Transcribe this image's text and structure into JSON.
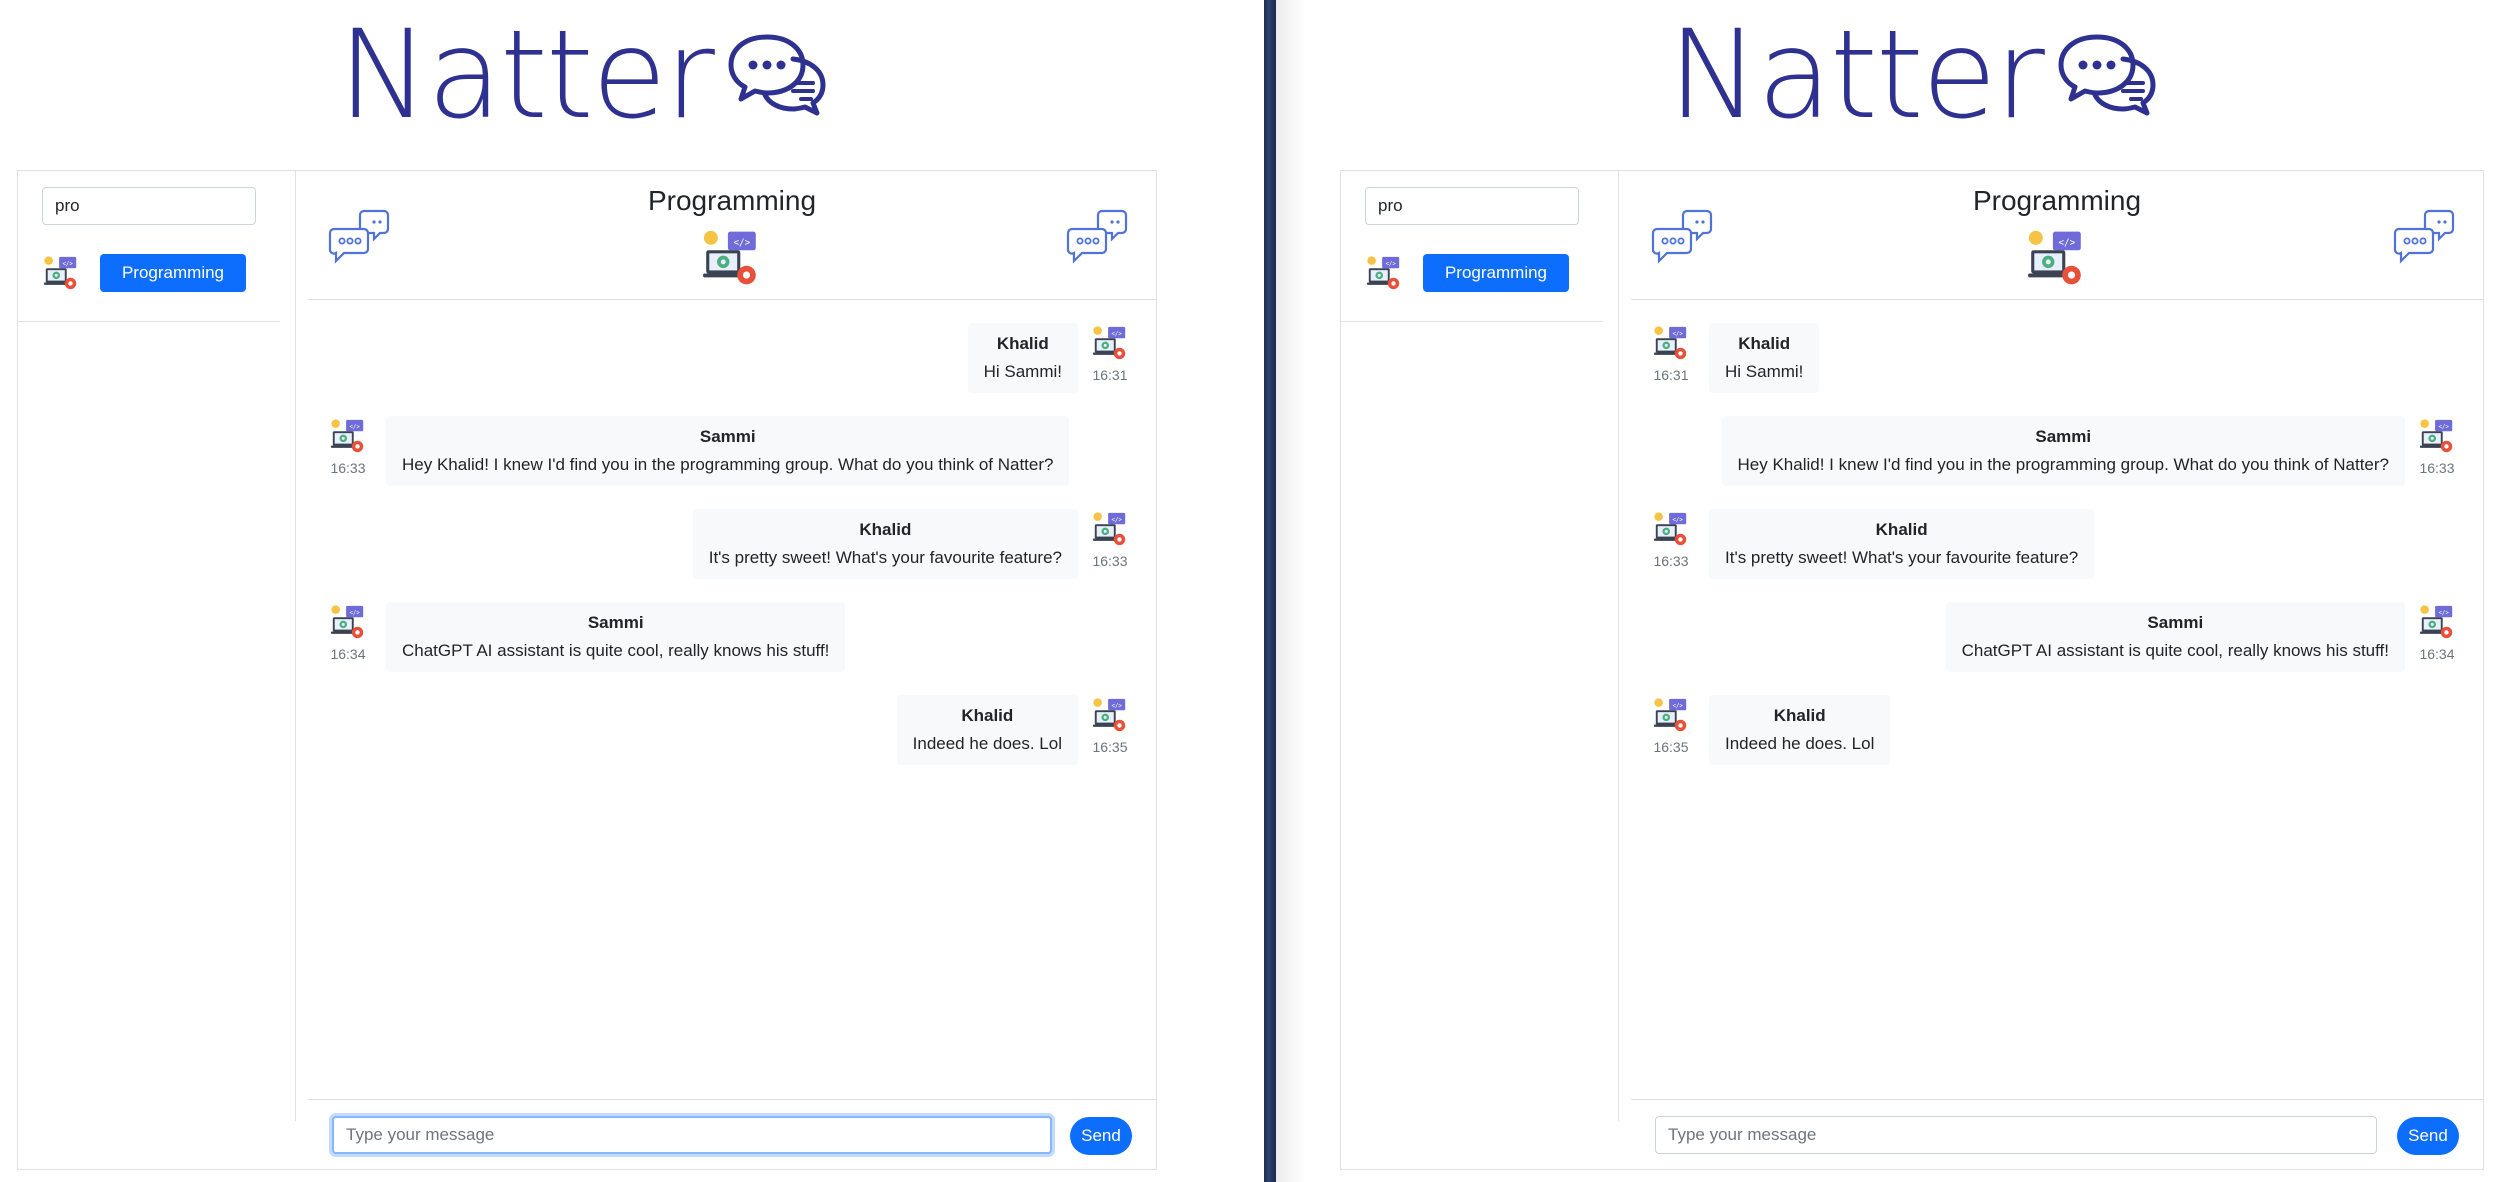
{
  "brand": {
    "name": "Natter"
  },
  "sidebar": {
    "search_value": "pro",
    "groups": [
      {
        "label": "Programming"
      }
    ]
  },
  "chat": {
    "title": "Programming",
    "composer_placeholder": "Type your message",
    "send_label": "Send"
  },
  "windows": [
    {
      "messages": [
        {
          "sender": "Khalid",
          "text": "Hi Sammi!",
          "time": "16:31",
          "align": "right"
        },
        {
          "sender": "Sammi",
          "text": "Hey Khalid! I knew I'd find you in the programming group. What do you think of Natter?",
          "time": "16:33",
          "align": "left"
        },
        {
          "sender": "Khalid",
          "text": "It's pretty sweet! What's your favourite feature?",
          "time": "16:33",
          "align": "right"
        },
        {
          "sender": "Sammi",
          "text": "ChatGPT AI assistant is quite cool, really knows his stuff!",
          "time": "16:34",
          "align": "left"
        },
        {
          "sender": "Khalid",
          "text": "Indeed he does. Lol",
          "time": "16:35",
          "align": "right"
        }
      ]
    },
    {
      "messages": [
        {
          "sender": "Khalid",
          "text": "Hi Sammi!",
          "time": "16:31",
          "align": "left"
        },
        {
          "sender": "Sammi",
          "text": "Hey Khalid! I knew I'd find you in the programming group. What do you think of Natter?",
          "time": "16:33",
          "align": "right"
        },
        {
          "sender": "Khalid",
          "text": "It's pretty sweet! What's your favourite feature?",
          "time": "16:33",
          "align": "left"
        },
        {
          "sender": "Sammi",
          "text": "ChatGPT AI assistant is quite cool, really knows his stuff!",
          "time": "16:34",
          "align": "right"
        },
        {
          "sender": "Khalid",
          "text": "Indeed he does. Lol",
          "time": "16:35",
          "align": "left"
        }
      ]
    }
  ],
  "colors": {
    "brand": "#2f3190",
    "primary": "#0d6efd",
    "bubble_bg": "#f8f9fa"
  },
  "icons": {
    "logo": "chat-bubbles-icon",
    "avatar": "programming-laptop-icon",
    "header_decor": "speech-bubbles-icon"
  }
}
